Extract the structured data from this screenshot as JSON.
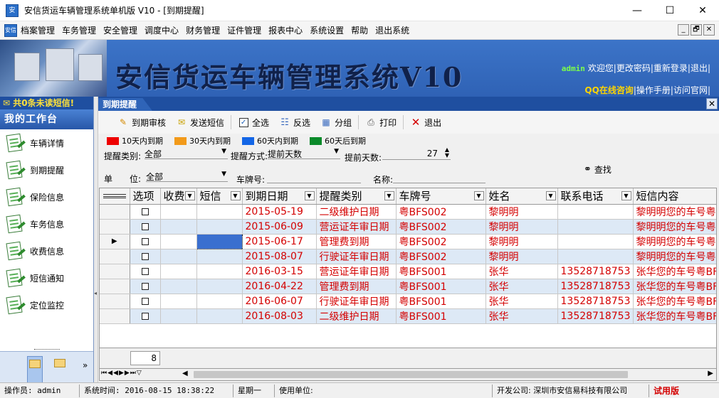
{
  "window": {
    "title": "安信货运车辆管理系统单机版 V10 - [到期提醒]",
    "icon_text": "安信",
    "controls": [
      "—",
      "☐",
      "✕"
    ]
  },
  "menu": {
    "icon_text": "安信",
    "items": [
      "档案管理",
      "车务管理",
      "安全管理",
      "调度中心",
      "财务管理",
      "证件管理",
      "报表中心",
      "系统设置",
      "帮助",
      "退出系统"
    ],
    "mdi_controls": [
      "_",
      "🗗",
      "✕"
    ]
  },
  "banner": {
    "system_title": "安信货运车辆管理系统V10",
    "user": "admin",
    "welcome": "欢迎您",
    "links": [
      "更改密码",
      "重新登录",
      "退出"
    ],
    "qq": "QQ在线咨询",
    "links2": [
      "操作手册",
      "访问官网"
    ]
  },
  "left": {
    "sms_notice": "共0条未读短信!",
    "workbench_title": "我的工作台",
    "items": [
      "车辆详情",
      "到期提醒",
      "保险信息",
      "车务信息",
      "收费信息",
      "短信通知",
      "定位监控"
    ],
    "more": "»"
  },
  "tab": {
    "label": "到期提醒",
    "close": "✕"
  },
  "toolbar": {
    "buttons": [
      "到期审核",
      "发送短信",
      "全选",
      "反选",
      "分组",
      "打印",
      "退出"
    ]
  },
  "legend": [
    {
      "label": "10天内到期",
      "color": "#ee0000"
    },
    {
      "label": "30天内到期",
      "color": "#f29a1a"
    },
    {
      "label": "60天内到期",
      "color": "#1366e6"
    },
    {
      "label": "60天后到期",
      "color": "#0a8a2a"
    }
  ],
  "filters": {
    "type_label": "提醒类别:",
    "type_value": "全部",
    "mode_label": "提醒方式:",
    "mode_value": "提前天数",
    "days_label": "提前天数:",
    "days_value": "27",
    "unit_label_1": "单",
    "unit_label_2": "位:",
    "unit_value": "全部",
    "plate_label": "车牌号:",
    "name_label": "名称:",
    "search": "查找"
  },
  "grid": {
    "columns": [
      "选项",
      "收费",
      "短信",
      "到期日期",
      "提醒类别",
      "车牌号",
      "姓名",
      "联系电话",
      "短信内容"
    ],
    "rows": [
      [
        "2015-05-19",
        "二级维护日期",
        "粤BFS002",
        "黎明明",
        "",
        "黎明明您的车号粤"
      ],
      [
        "2015-06-09",
        "营运证年审日期",
        "粤BFS002",
        "黎明明",
        "",
        "黎明明您的车号粤"
      ],
      [
        "2015-06-17",
        "管理费到期",
        "粤BFS002",
        "黎明明",
        "",
        "黎明明您的车号粤"
      ],
      [
        "2015-08-07",
        "行驶证年审日期",
        "粤BFS002",
        "黎明明",
        "",
        "黎明明您的车号粤"
      ],
      [
        "2016-03-15",
        "营运证年审日期",
        "粤BFS001",
        "张华",
        "13528718753",
        "张华您的车号粤BF"
      ],
      [
        "2016-04-22",
        "管理费到期",
        "粤BFS001",
        "张华",
        "13528718753",
        "张华您的车号粤BF"
      ],
      [
        "2016-06-07",
        "行驶证年审日期",
        "粤BFS001",
        "张华",
        "13528718753",
        "张华您的车号粤BF"
      ],
      [
        "2016-08-03",
        "二级维护日期",
        "粤BFS001",
        "张华",
        "13528718753",
        "张华您的车号粤BF"
      ]
    ],
    "current_row_marker": "▶",
    "record_count": "8",
    "nav_buttons": "⏮◀◀▶▶⏭▽"
  },
  "status": {
    "operator": "操作员: admin",
    "time": "系统时间: 2016-08-15 18:38:22",
    "weekday": "星期一",
    "unit": "使用单位:",
    "developer": "开发公司: 深圳市安信易科技有限公司",
    "trial": "试用版"
  }
}
